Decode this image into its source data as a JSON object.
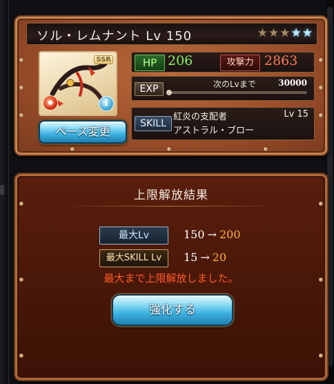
{
  "character": {
    "name": "ソル・レムナント Lv 150",
    "stars": [
      "dim",
      "dim",
      "dim",
      "lit",
      "lit"
    ],
    "rarity": "SSR",
    "element_icon": "fire-element-icon",
    "info_icon": "i",
    "base_change_label": "ベース変更"
  },
  "stats": {
    "hp_label": "HP",
    "hp_value": "206",
    "atk_label": "攻撃力",
    "atk_value": "2863",
    "exp_label": "EXP",
    "next_lv_label": "次のLvまで",
    "next_lv_value": "30000",
    "exp_progress": 0.0,
    "skill_label": "SKILL",
    "skill_name": "紅炎の支配者",
    "skill_lv": "Lv 15",
    "skill_name_2": "アストラル・ブロー"
  },
  "result": {
    "title": "上限解放結果",
    "max_lv_label": "最大Lv",
    "max_lv_from": "150",
    "max_lv_to": "200",
    "max_skill_label": "最大SKILL Lv",
    "max_skill_from": "15",
    "max_skill_to": "20",
    "arrow": "→",
    "message": "最大まで上限解放しました。",
    "enhance_label": "強化する"
  },
  "colors": {
    "accent_blue": "#3fb3e0",
    "hp_green": "#8cf06a",
    "atk_red": "#ff7a52",
    "result_orange": "#ffb04a",
    "message_red": "#ff5a2a"
  }
}
